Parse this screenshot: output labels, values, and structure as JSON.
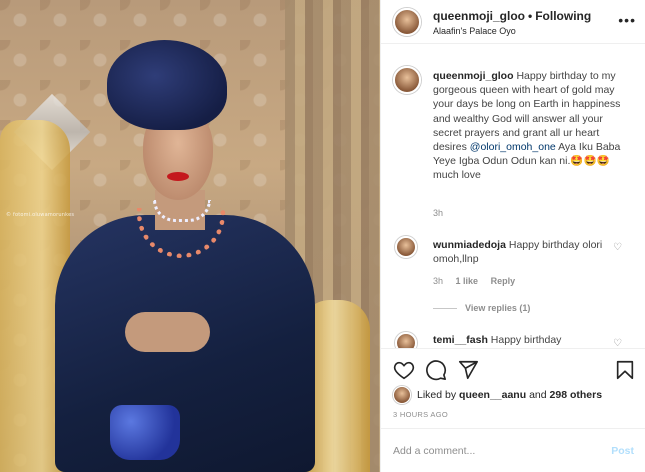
{
  "header": {
    "username": "queenmoji_gloo",
    "separator": "•",
    "follow_status": "Following",
    "location": "Alaafin's Palace Oyo",
    "more_icon": "more-horizontal-icon",
    "more_glyph": "•••"
  },
  "photo": {
    "watermark": "© fotomi.oluwamorunkes"
  },
  "caption": {
    "username": "queenmoji_gloo",
    "text_part1": "Happy birthday to my gorgeous queen with heart of gold may your days be long on Earth in happiness and wealthy God will answer all your secret prayers and grant all ur heart desires",
    "mention": "@olori_omoh_one",
    "text_part2": "Aya Iku Baba Yeye Igba Odun Odun kan ni.",
    "emojis": "🤩🤩🤩",
    "text_part3": "much love",
    "time": "3h"
  },
  "comments": [
    {
      "username": "wunmiadedoja",
      "text": "Happy birthday olori omoh,llnp",
      "time": "3h",
      "likes": "1 like",
      "reply": "Reply",
      "view_replies": "View replies (1)"
    },
    {
      "username": "temi__fash",
      "text": "Happy birthday"
    }
  ],
  "actions": {
    "like_icon": "heart-icon",
    "comment_icon": "comment-icon",
    "share_icon": "share-icon",
    "save_icon": "bookmark-icon"
  },
  "likes": {
    "prefix": "Liked by",
    "user": "queen__aanu",
    "middle": "and",
    "others": "298 others"
  },
  "timestamp": "3 HOURS AGO",
  "add_comment": {
    "placeholder": "Add a comment...",
    "post_label": "Post"
  },
  "colors": {
    "link": "#00376b",
    "muted": "#8e8e8e",
    "post_disabled": "#b2dffc",
    "border": "#efefef"
  }
}
